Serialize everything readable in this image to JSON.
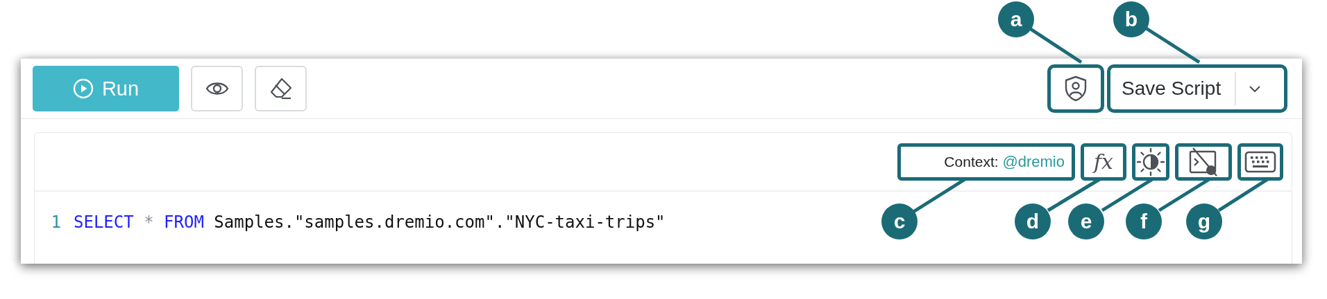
{
  "toolbar": {
    "left": [
      {
        "kind": "run",
        "label": "Run"
      },
      {
        "kind": "preview"
      },
      {
        "kind": "clear"
      }
    ],
    "right": [
      {
        "kind": "privileges",
        "highlighted": true
      },
      {
        "kind": "save",
        "label": "Save Script",
        "highlighted": true
      }
    ]
  },
  "editor": {
    "toolbar": [
      {
        "kind": "context",
        "label": "Context:",
        "value": "@dremio",
        "highlighted": true
      },
      {
        "kind": "functions",
        "glyph": "fx",
        "highlighted": true
      },
      {
        "kind": "theme",
        "highlighted": true
      },
      {
        "kind": "autocomplete",
        "highlighted": true
      },
      {
        "kind": "shortcuts",
        "highlighted": true
      }
    ],
    "lines": [
      {
        "number": "1",
        "tokens": [
          {
            "kind": "keyword",
            "text": "SELECT"
          },
          {
            "kind": "operator",
            "text": "*"
          },
          {
            "kind": "keyword",
            "text": "FROM"
          },
          {
            "kind": "identifier",
            "text": "Samples.\"samples.dremio.com\".\"NYC-taxi-trips\""
          }
        ]
      }
    ]
  },
  "callouts": [
    {
      "label": "a"
    },
    {
      "label": "b"
    },
    {
      "label": "c"
    },
    {
      "label": "d"
    },
    {
      "label": "e"
    },
    {
      "label": "f"
    },
    {
      "label": "g"
    }
  ]
}
